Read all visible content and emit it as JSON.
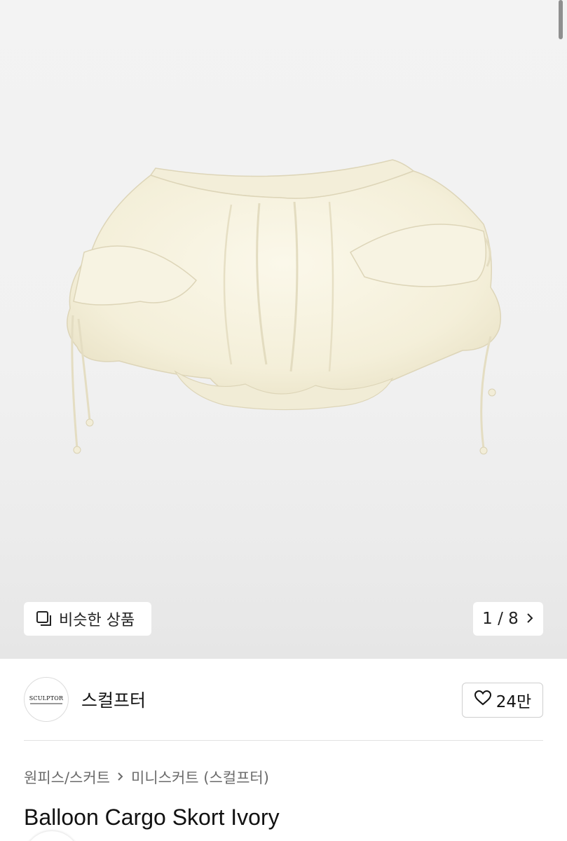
{
  "gallery": {
    "similar_label": "비슷한 상품",
    "counter": "1 / 8",
    "image_alt_icon": "product-image"
  },
  "seller": {
    "name": "스컬프터",
    "logo_text": "SCULPTOR",
    "like_count": "24만"
  },
  "product": {
    "category_main": "원피스/스커트",
    "category_sub": "미니스커트 (스컬프터)",
    "title": "Balloon Cargo Skort Ivory"
  },
  "colors": {
    "background": "#ffffff",
    "hero_background": "#f1f1f1",
    "garment": "#f7f3e2",
    "text": "#111111",
    "muted_text": "#6a6a6a"
  }
}
